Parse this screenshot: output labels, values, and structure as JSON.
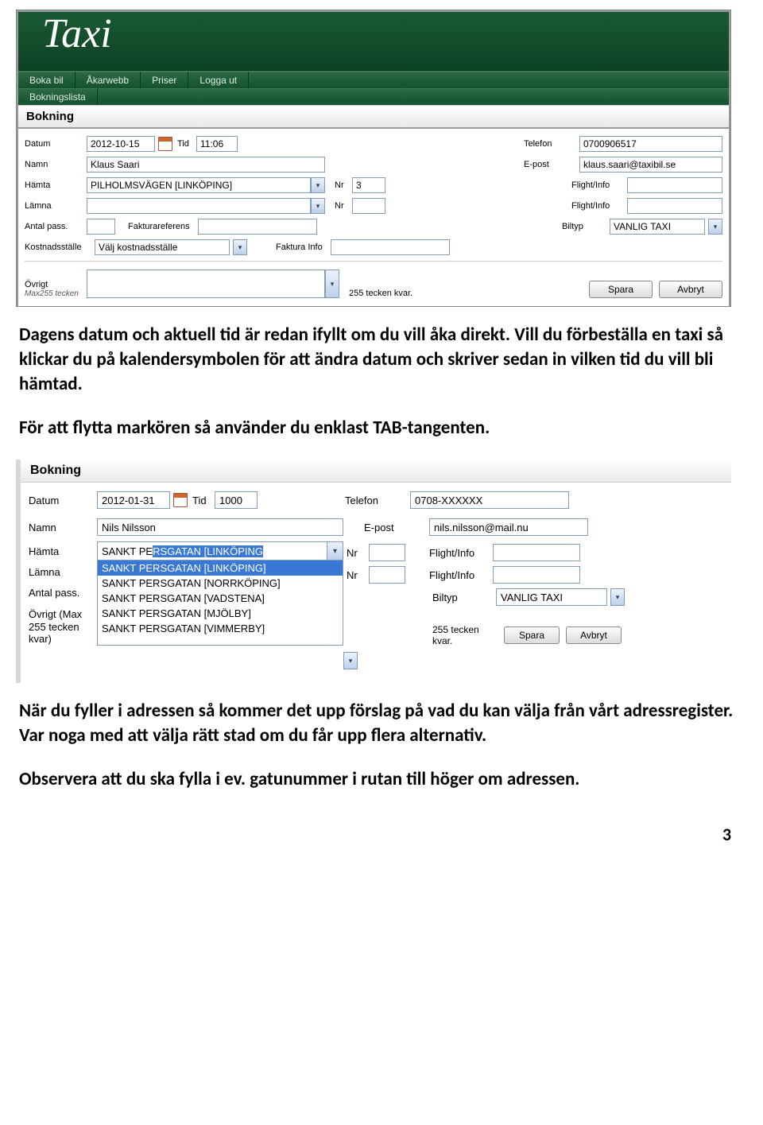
{
  "screenshot1": {
    "logo_text": "Taxi",
    "nav_row1": [
      "Boka bil",
      "Åkarwebb",
      "Priser",
      "Logga ut"
    ],
    "nav_row2": [
      "Bokningslista"
    ],
    "section_title": "Bokning",
    "labels": {
      "datum": "Datum",
      "tid": "Tid",
      "telefon": "Telefon",
      "namn": "Namn",
      "epost": "E-post",
      "hamta": "Hämta",
      "lamna": "Lämna",
      "nr": "Nr",
      "flight": "Flight/Info",
      "antal": "Antal pass.",
      "faktref": "Fakturareferens",
      "biltyp": "Biltyp",
      "kostst": "Kostnadsställe",
      "fakinfo": "Faktura Info",
      "ovrigt": "Övrigt",
      "maxnote": "Max255 tecken"
    },
    "values": {
      "datum": "2012-10-15",
      "tid": "11:06",
      "telefon": "0700906517",
      "namn": "Klaus Saari",
      "epost": "klaus.saari@taxibil.se",
      "hamta": "PILHOLMSVÄGEN [LINKÖPING]",
      "nr1": "3",
      "biltyp": "VANLIG TAXI",
      "kostst": "Välj kostnadsställe",
      "tecken_kvar": "255 tecken kvar."
    },
    "buttons": {
      "save": "Spara",
      "cancel": "Avbryt"
    }
  },
  "para1": "Dagens datum och aktuell tid är redan ifyllt om du vill åka direkt. Vill du förbeställa en taxi så klickar du på kalendersymbolen för att ändra datum och skriver sedan in vilken tid du vill bli hämtad.",
  "para2": "För att flytta markören så använder du enklast TAB-tangenten.",
  "screenshot2": {
    "section_title": "Bokning",
    "labels": {
      "datum": "Datum",
      "tid": "Tid",
      "telefon": "Telefon",
      "namn": "Namn",
      "epost": "E-post",
      "hamta": "Hämta",
      "lamna": "Lämna",
      "nr": "Nr",
      "flight": "Flight/Info",
      "antal": "Antal pass.",
      "biltyp": "Biltyp",
      "ovrigt": "Övrigt (Max 255 tecken kvar)",
      "tecknote": "255 tecken kvar."
    },
    "values": {
      "datum": "2012-01-31",
      "tid": "1000",
      "telefon": "0708-XXXXXX",
      "namn": "Nils Nilsson",
      "epost": "nils.nilsson@mail.nu",
      "hamta_pre": "SANKT PE",
      "hamta_hl": "RSGATAN [LINKÖPING",
      "biltyp": "VANLIG TAXI"
    },
    "dropdown_items": [
      "SANKT PERSGATAN [LINKÖPING]",
      "SANKT PERSGATAN [NORRKÖPING]",
      "SANKT PERSGATAN [VADSTENA]",
      "SANKT PERSGATAN [MJÖLBY]",
      "SANKT PERSGATAN [VIMMERBY]"
    ],
    "buttons": {
      "save": "Spara",
      "cancel": "Avbryt"
    }
  },
  "para3": "När du fyller i adressen så kommer det upp förslag på vad du kan välja från vårt adressregister. Var noga med att välja rätt stad om du får upp flera alternativ.",
  "para4": "Observera att du ska fylla i ev. gatunummer i rutan till höger om adressen.",
  "page_num": "3"
}
